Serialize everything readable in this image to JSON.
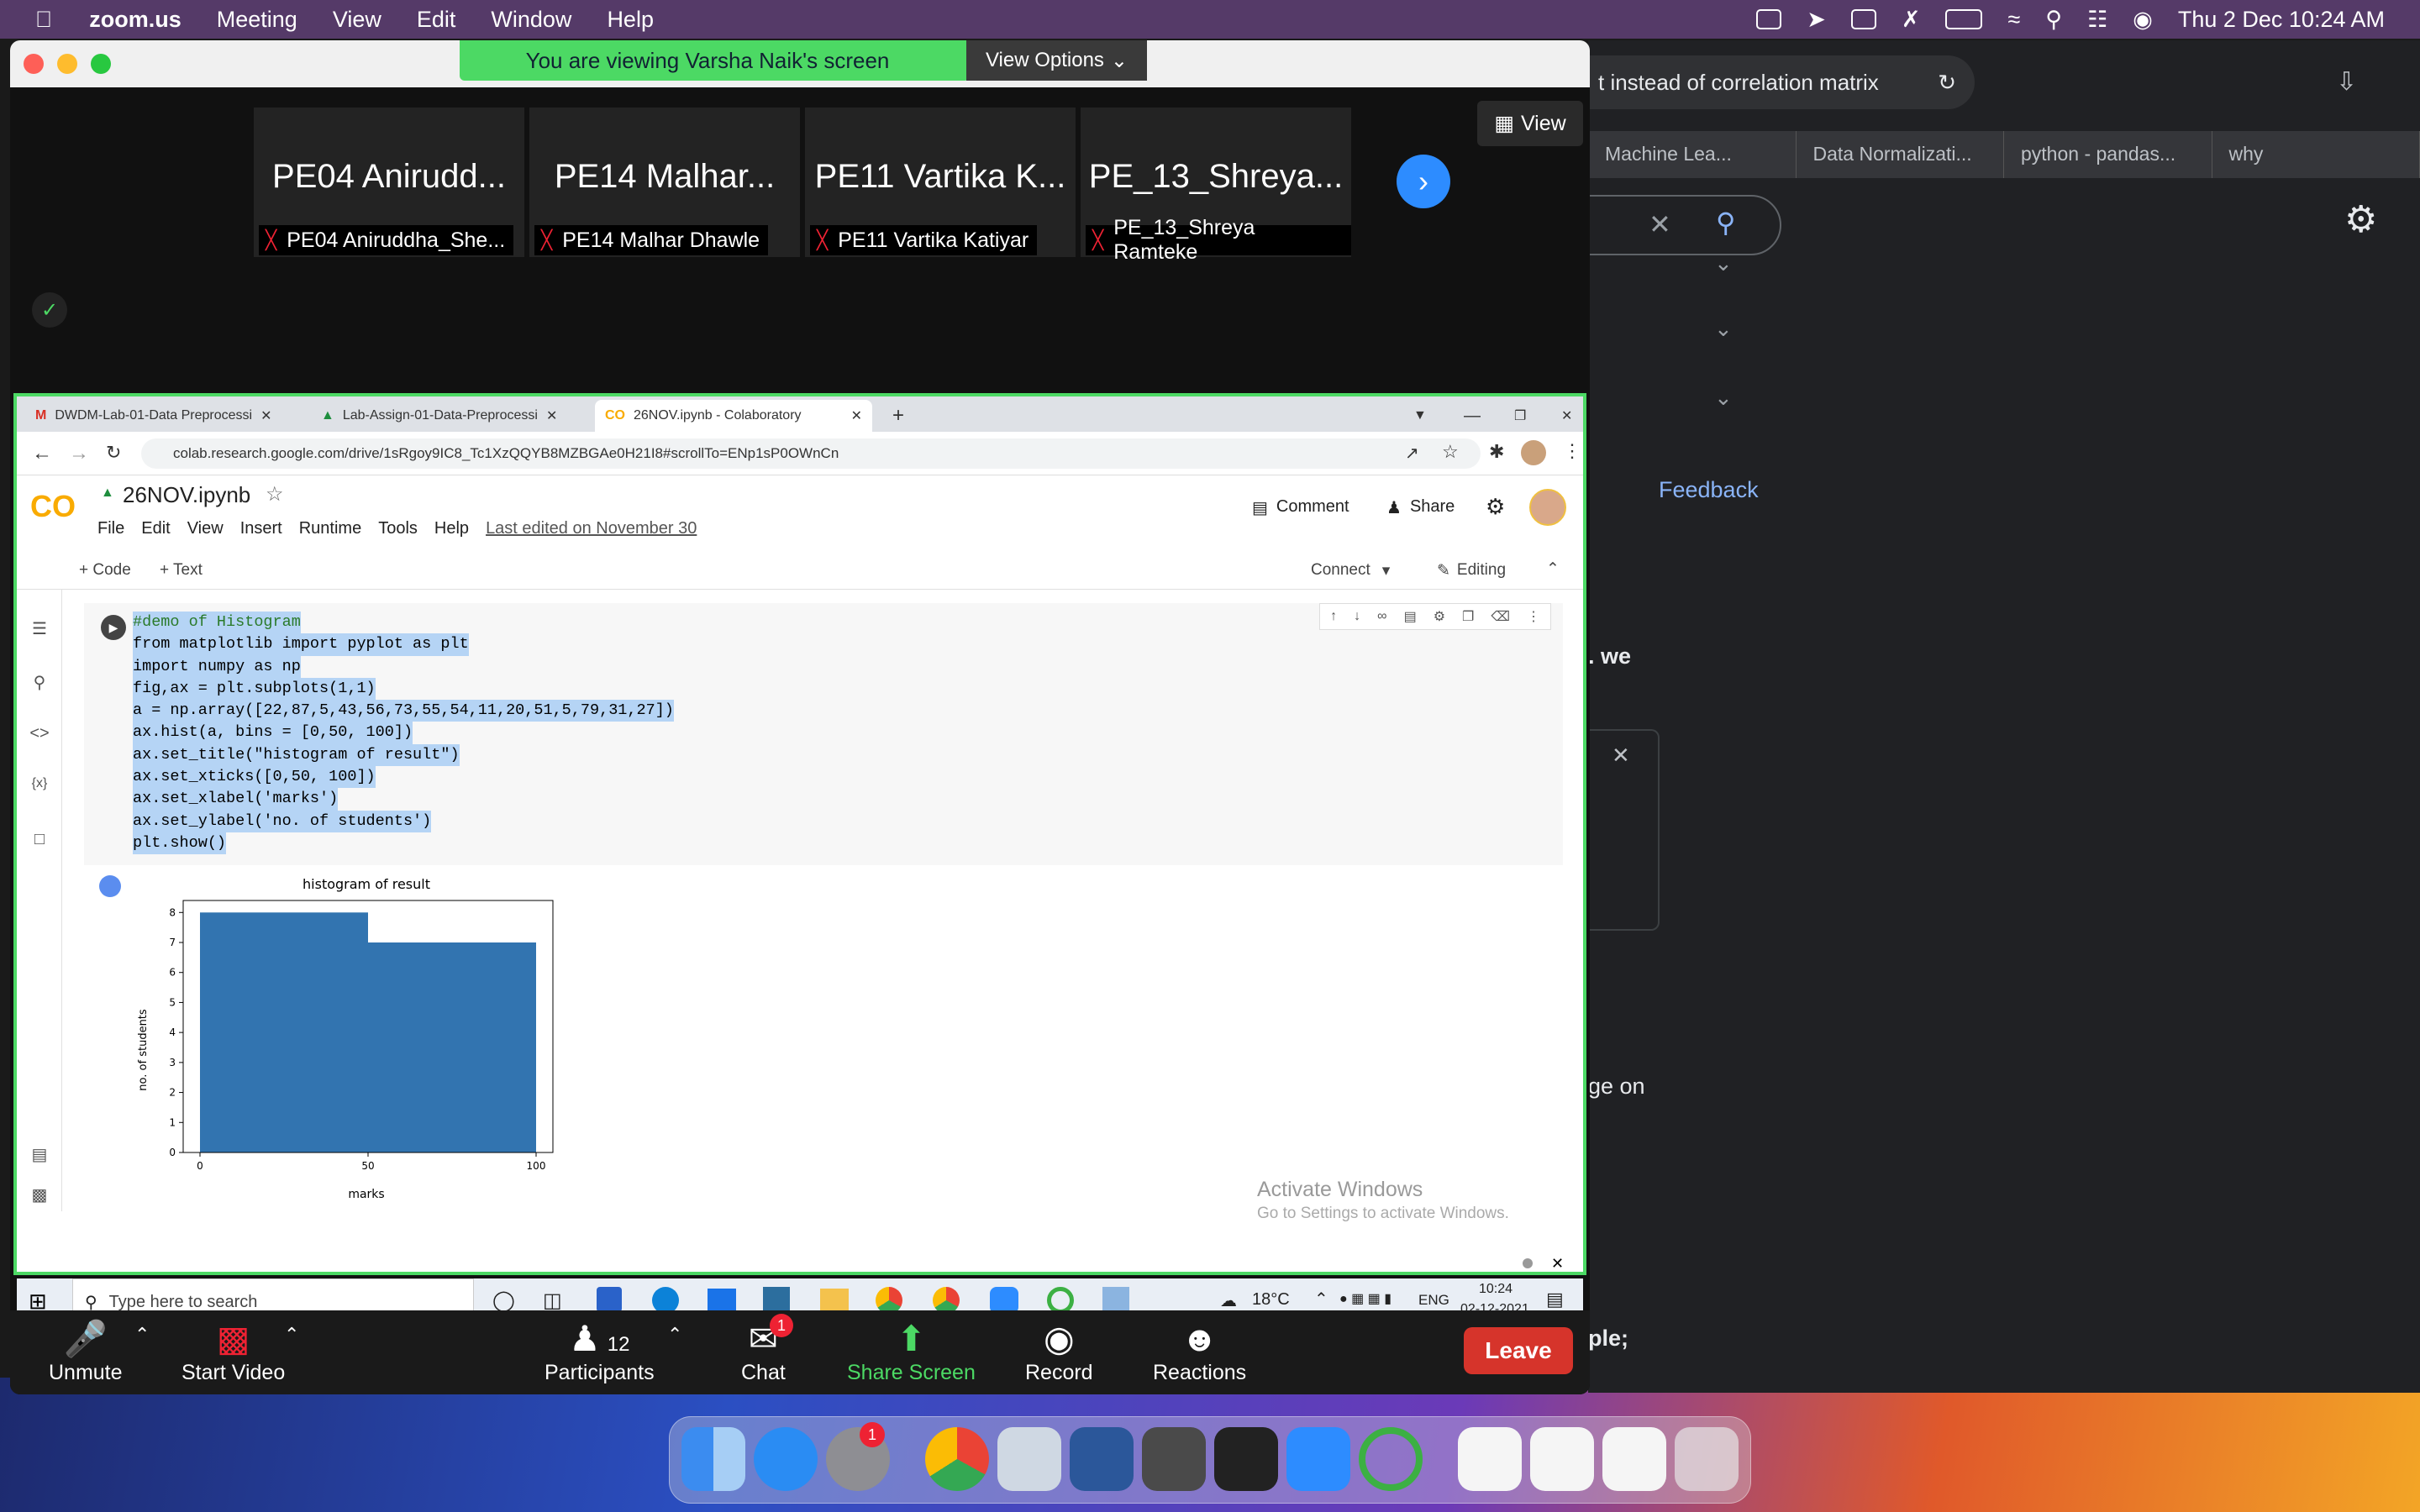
{
  "menubar": {
    "app": "zoom.us",
    "items": [
      "Meeting",
      "View",
      "Edit",
      "Window",
      "Help"
    ],
    "datetime": "Thu 2 Dec  10:24 AM"
  },
  "background_browser": {
    "address": "t instead of correlation matrix",
    "tabs": [
      "Machine Lea...",
      "Data Normalizati...",
      "python - pandas...",
      "why"
    ],
    "texts": [
      ". we",
      "Feedback",
      "ge on",
      "ple;"
    ]
  },
  "zoom": {
    "banner": "You are viewing Varsha Naik's screen",
    "view_options": "View Options",
    "view_button": "View",
    "participants": [
      {
        "big": "PE04 Anirudd...",
        "name": "PE04 Aniruddha_She..."
      },
      {
        "big": "PE14 Malhar...",
        "name": "PE14 Malhar Dhawle"
      },
      {
        "big": "PE11 Vartika K...",
        "name": "PE11 Vartika Katiyar"
      },
      {
        "big": "PE_13_Shreya...",
        "name": "PE_13_Shreya Ramteke"
      }
    ],
    "controls": {
      "unmute": "Unmute",
      "start_video": "Start Video",
      "participants": "Participants",
      "participants_count": "12",
      "chat": "Chat",
      "chat_badge": "1",
      "share_screen": "Share Screen",
      "record": "Record",
      "reactions": "Reactions",
      "leave": "Leave"
    }
  },
  "shared": {
    "tabs": [
      "DWDM-Lab-01-Data Preprocessi",
      "Lab-Assign-01-Data-Preprocessi",
      "26NOV.ipynb - Colaboratory"
    ],
    "url": "colab.research.google.com/drive/1sRgoy9IC8_Tc1XzQQYB8MZBGAe0H21I8#scrollTo=ENp1sP0OWnCn",
    "colab": {
      "logo": "CO",
      "filename": "26NOV.ipynb",
      "menus": [
        "File",
        "Edit",
        "View",
        "Insert",
        "Runtime",
        "Tools",
        "Help"
      ],
      "last_edited": "Last edited on November 30",
      "comment": "Comment",
      "share": "Share",
      "add_code": "+ Code",
      "add_text": "+ Text",
      "connect": "Connect",
      "editing": "Editing"
    },
    "code_lines": [
      "#demo of Histogram",
      "from matplotlib import pyplot as plt",
      "import numpy as np",
      "fig,ax = plt.subplots(1,1)",
      "a = np.array([22,87,5,43,56,73,55,54,11,20,51,5,79,31,27])",
      "ax.hist(a, bins = [0,50, 100])",
      "ax.set_title(\"histogram of result\")",
      "ax.set_xticks([0,50, 100])",
      "ax.set_xlabel('marks')",
      "ax.set_ylabel('no. of students')",
      "plt.show()"
    ],
    "activate": {
      "title": "Activate Windows",
      "sub": "Go to Settings to activate Windows."
    },
    "taskbar": {
      "search": "Type here to search",
      "temp": "18°C",
      "lang": "ENG",
      "time": "10:24",
      "date": "02-12-2021"
    }
  },
  "chart_data": {
    "type": "bar",
    "title": "histogram of result",
    "xlabel": "marks",
    "ylabel": "no. of students",
    "bins": [
      [
        0,
        50
      ],
      [
        50,
        100
      ]
    ],
    "values": [
      8,
      7
    ],
    "xticks": [
      0,
      50,
      100
    ],
    "yticks": [
      0,
      1,
      2,
      3,
      4,
      5,
      6,
      7,
      8
    ],
    "xlim": [
      -5,
      105
    ],
    "ylim": [
      0,
      8.4
    ],
    "color": "#3274b0"
  },
  "dock_badge": "1"
}
